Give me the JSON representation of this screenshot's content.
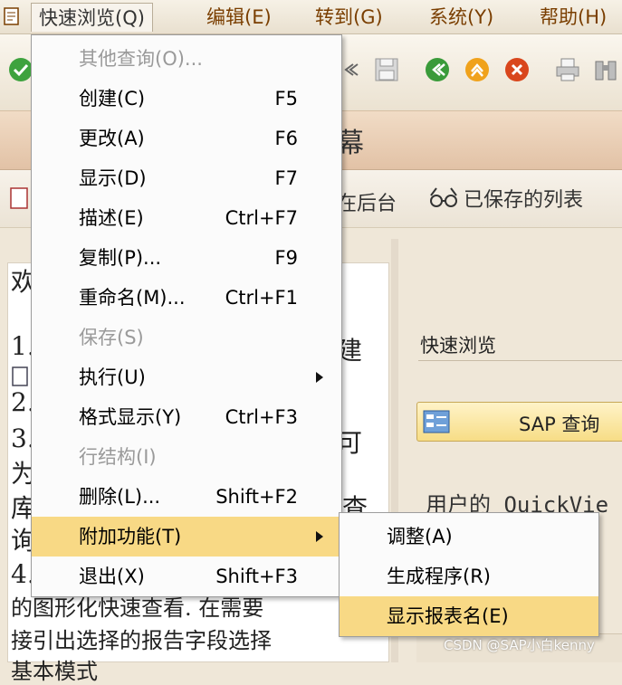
{
  "menubar": {
    "items": [
      {
        "label": "快速浏览(Q)",
        "active": true
      },
      {
        "label": "编辑(E)"
      },
      {
        "label": "转到(G)"
      },
      {
        "label": "系统(Y)"
      },
      {
        "label": "帮助(H)"
      }
    ]
  },
  "title": {
    "text": "幕"
  },
  "app_toolbar": {
    "background_text": "在后台",
    "saved_lists_label": "已保存的列表"
  },
  "left_doc": {
    "lines": [
      "欢",
      "1.",
      "",
      "2.",
      "3.",
      "为",
      "库",
      "询",
      "4.",
      "的图形化快速查看. 在需要",
      "接引出选择的报告字段选择",
      "基本模式"
    ],
    "right_fragments": [
      "建",
      "可",
      "查"
    ]
  },
  "right_panel": {
    "quickview_label": "快速浏览",
    "sap_query_label": "SAP 查询",
    "user_quickview_text": "用户的 QuickVie"
  },
  "menu": {
    "items": [
      {
        "label": "其他查询(O)...",
        "shortcut": "",
        "disabled": true
      },
      {
        "label": "创建(C)",
        "shortcut": "F5"
      },
      {
        "label": "更改(A)",
        "shortcut": "F6"
      },
      {
        "label": "显示(D)",
        "shortcut": "F7"
      },
      {
        "label": "描述(E)",
        "shortcut": "Ctrl+F7"
      },
      {
        "label": "复制(P)...",
        "shortcut": "F9"
      },
      {
        "label": "重命名(M)...",
        "shortcut": "Ctrl+F1"
      },
      {
        "label": "保存(S)",
        "shortcut": "",
        "disabled": true
      },
      {
        "label": "执行(U)",
        "shortcut": "",
        "submenu": true
      },
      {
        "label": "格式显示(Y)",
        "shortcut": "Ctrl+F3"
      },
      {
        "label": "行结构(I)",
        "shortcut": "",
        "disabled": true
      },
      {
        "label": "删除(L)...",
        "shortcut": "Shift+F2"
      },
      {
        "label": "附加功能(T)",
        "shortcut": "",
        "submenu": true,
        "highlighted": true
      },
      {
        "label": "退出(X)",
        "shortcut": "Shift+F3"
      }
    ]
  },
  "submenu": {
    "items": [
      {
        "label": "调整(A)"
      },
      {
        "label": "生成程序(R)"
      },
      {
        "label": "显示报表名(E)",
        "highlighted": true
      }
    ]
  },
  "watermark": "CSDN @SAP小白kenny",
  "colors": {
    "highlight": "#f8d985",
    "menubar_text": "#7a3e00",
    "title_band": "#e2c2a6"
  }
}
